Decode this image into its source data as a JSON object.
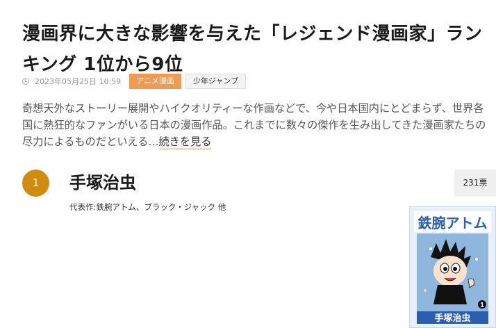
{
  "article": {
    "title": "漫画界に大きな影響を与えた「レジェンド漫画家」ランキング 1位から9位",
    "date": "2023年05月25日 10:59",
    "tags": [
      "アニメ漫画",
      "少年ジャンプ"
    ],
    "lead": "奇想天外なストーリー展開やハイクオリティーな作画などで、今や日本国内にとどまらず、世界各国に熱狂的なファンがいる日本の漫画作品。これまでに数々の傑作を生み出してきた漫画家たちの尽力によるものだといえる…",
    "read_more": "続きを見る"
  },
  "ranking": [
    {
      "rank": "1",
      "name": "手塚治虫",
      "works": "代表作:鉄腕アトム、ブラック・ジャック 他",
      "votes": "231票",
      "cover": {
        "title": "鉄腕アトム",
        "author": "手塚治虫",
        "volume": "1"
      }
    }
  ],
  "colors": {
    "tag_primary": "#ed9b56",
    "rank_badge": "#d08c0e",
    "underline": "#f7dda8"
  },
  "icons": {
    "date": "clock-icon"
  }
}
